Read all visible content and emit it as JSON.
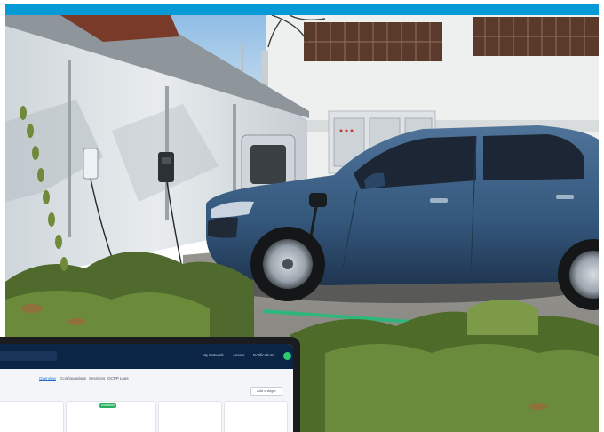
{
  "app": {
    "nav": [
      "My Network",
      "Assets",
      "Notifications"
    ],
    "tabs": [
      "Overview",
      "Configurations",
      "Sessions",
      "OCPP Logs"
    ],
    "add_label": "Add charger",
    "status_chip": "Available"
  },
  "colors": {
    "accent": "#089ad6",
    "car_body": "#3e5f84",
    "status_green": "#27ae60"
  }
}
